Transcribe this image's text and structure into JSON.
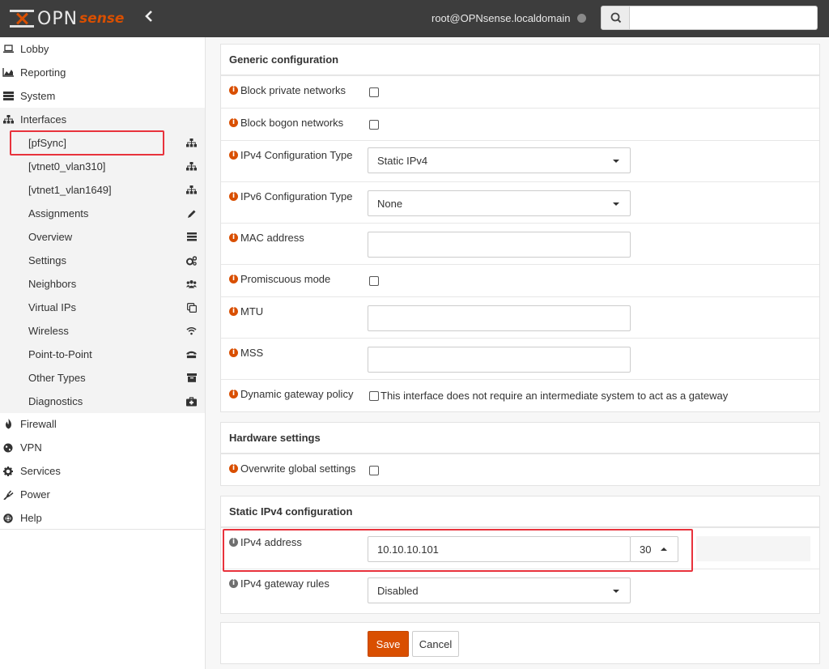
{
  "header": {
    "logo_text": "OPN",
    "logo_accent": "sense",
    "user": "root@OPNsense.localdomain",
    "search_placeholder": ""
  },
  "sidebar": {
    "items": [
      {
        "label": "Lobby",
        "icon": "laptop-icon"
      },
      {
        "label": "Reporting",
        "icon": "area-chart-icon"
      },
      {
        "label": "System",
        "icon": "server-icon"
      },
      {
        "label": "Interfaces",
        "icon": "sitemap-icon"
      }
    ],
    "sub_items": [
      {
        "label": "[pfSync]",
        "icon": "sitemap-icon"
      },
      {
        "label": "[vtnet0_vlan310]",
        "icon": "sitemap-icon"
      },
      {
        "label": "[vtnet1_vlan1649]",
        "icon": "sitemap-icon"
      },
      {
        "label": "Assignments",
        "icon": "pencil-icon"
      },
      {
        "label": "Overview",
        "icon": "tasks-icon"
      },
      {
        "label": "Settings",
        "icon": "cogs-icon"
      },
      {
        "label": "Neighbors",
        "icon": "users-icon"
      },
      {
        "label": "Virtual IPs",
        "icon": "clone-icon"
      },
      {
        "label": "Wireless",
        "icon": "wifi-icon"
      },
      {
        "label": "Point-to-Point",
        "icon": "tty-icon"
      },
      {
        "label": "Other Types",
        "icon": "archive-icon"
      },
      {
        "label": "Diagnostics",
        "icon": "medkit-icon"
      }
    ],
    "bottom_items": [
      {
        "label": "Firewall",
        "icon": "fire-icon"
      },
      {
        "label": "VPN",
        "icon": "globe-icon"
      },
      {
        "label": "Services",
        "icon": "cog-icon"
      },
      {
        "label": "Power",
        "icon": "plug-icon"
      },
      {
        "label": "Help",
        "icon": "life-ring-icon"
      }
    ]
  },
  "generic": {
    "title": "Generic configuration",
    "block_private": "Block private networks",
    "block_bogon": "Block bogon networks",
    "ipv4_type_label": "IPv4 Configuration Type",
    "ipv4_type_value": "Static IPv4",
    "ipv6_type_label": "IPv6 Configuration Type",
    "ipv6_type_value": "None",
    "mac_label": "MAC address",
    "mac_value": "",
    "promiscuous_label": "Promiscuous mode",
    "mtu_label": "MTU",
    "mtu_value": "",
    "mss_label": "MSS",
    "mss_value": "",
    "dyn_gw_label": "Dynamic gateway policy",
    "dyn_gw_text": "This interface does not require an intermediate system to act as a gateway"
  },
  "hardware": {
    "title": "Hardware settings",
    "overwrite_label": "Overwrite global settings"
  },
  "static_ipv4": {
    "title": "Static IPv4 configuration",
    "address_label": "IPv4 address",
    "address_value": "10.10.10.101",
    "subnet_value": "30",
    "gw_rules_label": "IPv4 gateway rules",
    "gw_rules_value": "Disabled"
  },
  "actions": {
    "save": "Save",
    "cancel": "Cancel"
  },
  "colors": {
    "accent": "#d94f00",
    "highlight": "#e8323c",
    "topbar": "#3d3d3d"
  }
}
